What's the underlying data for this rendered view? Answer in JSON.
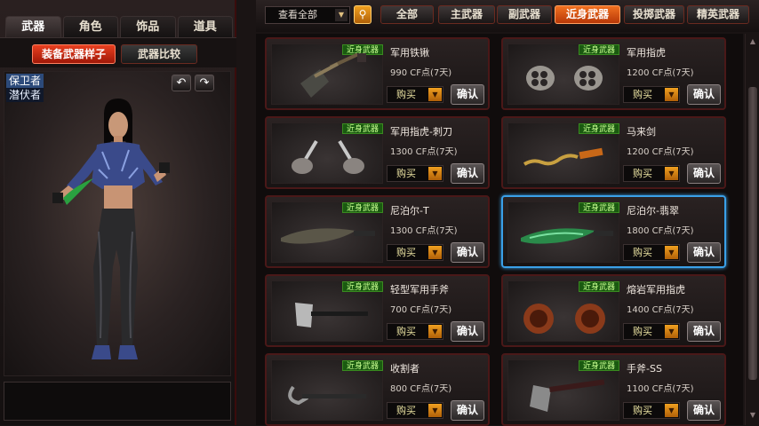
{
  "left_tabs": [
    "武器",
    "角色",
    "饰品",
    "道具"
  ],
  "left_buttons": {
    "equip_sample": "装备武器样子",
    "compare": "武器比较"
  },
  "modes": [
    "保卫者",
    "潜伏者"
  ],
  "rotate": {
    "left": "↶",
    "right": "↷"
  },
  "filter": {
    "value": "查看全部"
  },
  "categories": [
    "全部",
    "主武器",
    "副武器",
    "近身武器",
    "投掷武器",
    "精英武器"
  ],
  "active_category": "近身武器",
  "card_labels": {
    "tag": "近身武器",
    "buy": "购买",
    "confirm": "确认"
  },
  "items": [
    {
      "name": "军用铁锹",
      "price": "990 CF点(7天)"
    },
    {
      "name": "军用指虎",
      "price": "1200 CF点(7天)"
    },
    {
      "name": "军用指虎-刺刀",
      "price": "1300 CF点(7天)"
    },
    {
      "name": "马来剑",
      "price": "1200 CF点(7天)"
    },
    {
      "name": "尼泊尔-T",
      "price": "1300 CF点(7天)"
    },
    {
      "name": "尼泊尔-翡翠",
      "price": "1800 CF点(7天)",
      "selected": true
    },
    {
      "name": "轻型军用手斧",
      "price": "700 CF点(7天)"
    },
    {
      "name": "熔岩军用指虎",
      "price": "1400 CF点(7天)"
    },
    {
      "name": "收割者",
      "price": "800 CF点(7天)"
    },
    {
      "name": "手斧-SS",
      "price": "1100 CF点(7天)"
    }
  ],
  "colors": {
    "accent_red": "#e84020",
    "active_orange": "#f07020",
    "select_blue": "#3aa0e8",
    "tag_green": "#1a5a10"
  }
}
